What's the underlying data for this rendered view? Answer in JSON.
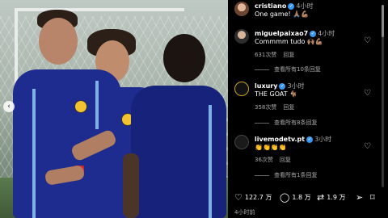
{
  "post": {
    "author": "cristiano",
    "time": "4小时",
    "caption": "One game! 🙏🏽💪🏽",
    "carousel_icon": "chevron-left-icon"
  },
  "comments": [
    {
      "username": "miguelpaixao7",
      "time": "4小时",
      "text": "Commmm tudo 🙌🏽💪🏽",
      "likes": "631次赞",
      "reply": "回复",
      "view_replies": "查看所有10条回复"
    },
    {
      "username": "luxury",
      "time": "3小时",
      "text": "THE GOAT 🐐",
      "likes": "358次赞",
      "reply": "回复",
      "view_replies": "查看所有8条回复"
    },
    {
      "username": "livemodetv.pt",
      "time": "3小时",
      "text": "👏👏👏👏",
      "likes": "36次赞",
      "reply": "回复",
      "view_replies": "查看所有1条回复"
    }
  ],
  "actions": {
    "likes": "122.7 万",
    "comments": "1.8 万",
    "reposts": "1.9 万"
  },
  "footer": {
    "time": "4小时前"
  },
  "colors": {
    "verified": "#3897f0",
    "jersey": "#1e2b8f",
    "badge": "#f2c230"
  }
}
